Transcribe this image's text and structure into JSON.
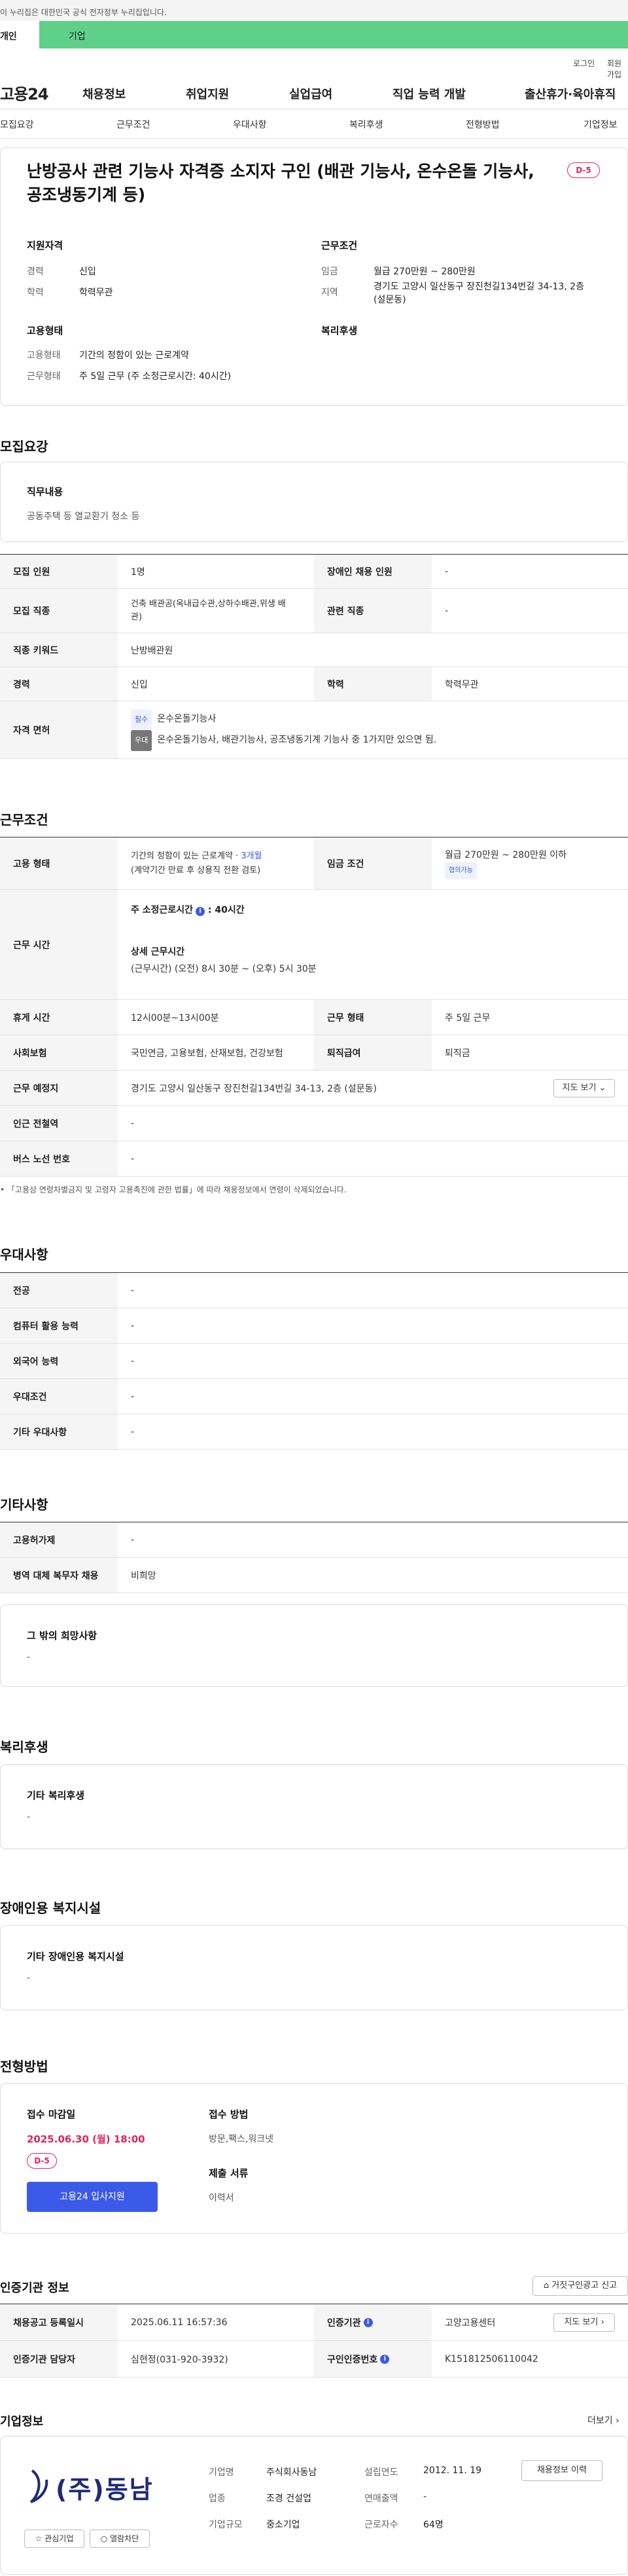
{
  "gov_banner": "이 누리집은 대한민국 공식 전자정부 누리집입니다.",
  "top_tabs": [
    "개인",
    "기업"
  ],
  "util": [
    "로그인",
    "회원가입"
  ],
  "logo": "고용24",
  "gnb": [
    "채용정보",
    "취업지원",
    "실업급여",
    "직업 능력 개발",
    "출산휴가·육아휴직"
  ],
  "lnb": [
    "모집요강",
    "근무조건",
    "우대사항",
    "복리후생",
    "전형방법",
    "기업정보"
  ],
  "job": {
    "title_line1": "난방공사 관련 기능사 자격증 소지자 구인 (배관 기능사, 온수온돌 기능사,",
    "title_line2": "공조냉동기계 등)",
    "dday": "D-5",
    "qual_head": "지원자격",
    "career_k": "경력",
    "career_v": "신입",
    "edu_k": "학력",
    "edu_v": "학력무관",
    "cond_head": "근무조건",
    "wage_k": "임금",
    "wage_v": "월급 270만원 ~ 280만원",
    "area_k": "지역",
    "area_v1": "경기도 고양시 일산동구 장진천길134번길 34-13, 2층",
    "area_v2": "(설문동)",
    "emp_head": "고용형태",
    "etype_k": "고용형태",
    "etype_v": "기간의 정함이 있는 근로계약",
    "whours_k": "근무형태",
    "whours_v": "주 5일 근무 (주 소정근로시간: 40시간)",
    "welfare_head": "복리후생"
  },
  "recruit": {
    "section": "모집요강",
    "duty_head": "직무내용",
    "duty_text": "공동주택 등 열교환기 청소 등",
    "rows": {
      "r1": {
        "k1": "모집 인원",
        "v1": "1명",
        "k2": "장애인 채용 인원",
        "v2": "-"
      },
      "r2": {
        "k1": "모집 직종",
        "v1a": "건축 배관공(옥내급수관,상하수배관,위생 배",
        "v1b": "관)",
        "k2": "관련 직종",
        "v2": "-"
      },
      "r3": {
        "k1": "직종 키워드",
        "v1": "난방배관원"
      },
      "r4": {
        "k1": "경력",
        "v1": "신입",
        "k2": "학력",
        "v2": "학력무관"
      },
      "r5": {
        "k1": "자격 면허",
        "tag1": "필수",
        "t1": "온수온돌기능사",
        "tag2": "우대",
        "t2": "온수온돌기능사, 배관기능사, 공조냉동기계 기능사 중 1가지만 있으면 됨."
      }
    }
  },
  "conditions": {
    "section": "근무조건",
    "etype_k": "고용 형태",
    "etype_v": "기간의 정함이 있는 근로계약 · ",
    "etype_months": "3개월",
    "etype_note": "(계약기간 만료 후 상용직 전환 검토)",
    "wage_k": "임금 조건",
    "wage_v": "월급 270만원 ~ 280만원 이하",
    "wage_tag": "협의가능",
    "hours_k": "근무 시간",
    "hours_std": "주 소정근로시간",
    "hours_std_v": "40시간",
    "hours_detail_head": "상세 근무시간",
    "hours_detail": "(근무시간) (오전) 8시 30분 ~ (오후) 5시 30분",
    "rest_k": "휴게 시간",
    "rest_v": "12시00분~13시00분",
    "wtype_k": "근무 형태",
    "wtype_v": "주 5일 근무",
    "ins_k": "사회보험",
    "ins_v": "국민연금, 고용보험, 산재보험, 건강보험",
    "sev_k": "퇴직급여",
    "sev_v": "퇴직금",
    "place_k": "근무 예정지",
    "place_v": "경기도 고양시 일산동구 장진천길134번길 34-13, 2층 (설문동)",
    "map_btn": "지도 보기",
    "sub_k": "인근 전철역",
    "sub_v": "-",
    "bus_k": "버스 노선 번호",
    "bus_v": "-",
    "note": "「고용상 연령차별금지 및 고령자 고용촉진에 관한 법률」에 따라 채용정보에서 연령이 삭제되었습니다."
  },
  "pref": {
    "section": "우대사항",
    "rows": [
      {
        "k": "전공",
        "v": "-"
      },
      {
        "k": "컴퓨터 활용 능력",
        "v": "-"
      },
      {
        "k": "외국어 능력",
        "v": "-"
      },
      {
        "k": "우대조건",
        "v": "-"
      },
      {
        "k": "기타 우대사항",
        "v": "-"
      }
    ]
  },
  "etc": {
    "section": "기타사항",
    "rows": [
      {
        "k": "고용허가제",
        "v": "-"
      },
      {
        "k": "병역 대체 복무자 채용",
        "v": "비희망"
      }
    ],
    "extra_head": "그 밖의 희망사항",
    "extra_v": "-"
  },
  "welfare": {
    "section": "복리후생",
    "head": "기타 복리후생",
    "v": "-"
  },
  "disabled": {
    "section": "장애인용 복지시설",
    "head": "기타 장애인용 복지시설",
    "v": "-"
  },
  "screening": {
    "section": "전형방법",
    "deadline_head": "접수 마감일",
    "deadline": "2025.06.30 (월) 18:00",
    "dday": "D-5",
    "apply_btn": "고용24 입사지원",
    "method_head": "접수 방법",
    "method_v": "방문,팩스,워크넷",
    "docs_head": "제출 서류",
    "docs_v": "이력서"
  },
  "agency": {
    "section": "인증기관 정보",
    "report_btn": "거짓구인광고 신고",
    "reg_k": "채용공고 등록일시",
    "reg_v": "2025.06.11 16:57:36",
    "org_k": "인증기관",
    "org_v": "고양고용센터",
    "org_btn": "지도 보기",
    "staff_k": "인증기관 담당자",
    "staff_v": "심현정(031-920-3932)",
    "no_k": "구인인증번호",
    "no_v": "K151812506110042"
  },
  "company": {
    "section": "기업정보",
    "more": "더보기",
    "logo_text": "(주)동남",
    "fav_btn": "관심기업",
    "block_btn": "열람차단",
    "name_k": "기업명",
    "name_v": "주식회사동남",
    "ind_k": "업종",
    "ind_v": "조경 건설업",
    "size_k": "기업규모",
    "size_v": "중소기업",
    "est_k": "설립연도",
    "est_v": "2012. 11. 19",
    "sales_k": "연매출액",
    "sales_v": "-",
    "emp_k": "근로자수",
    "emp_v": "64명",
    "history_btn": "채용정보 이력"
  }
}
